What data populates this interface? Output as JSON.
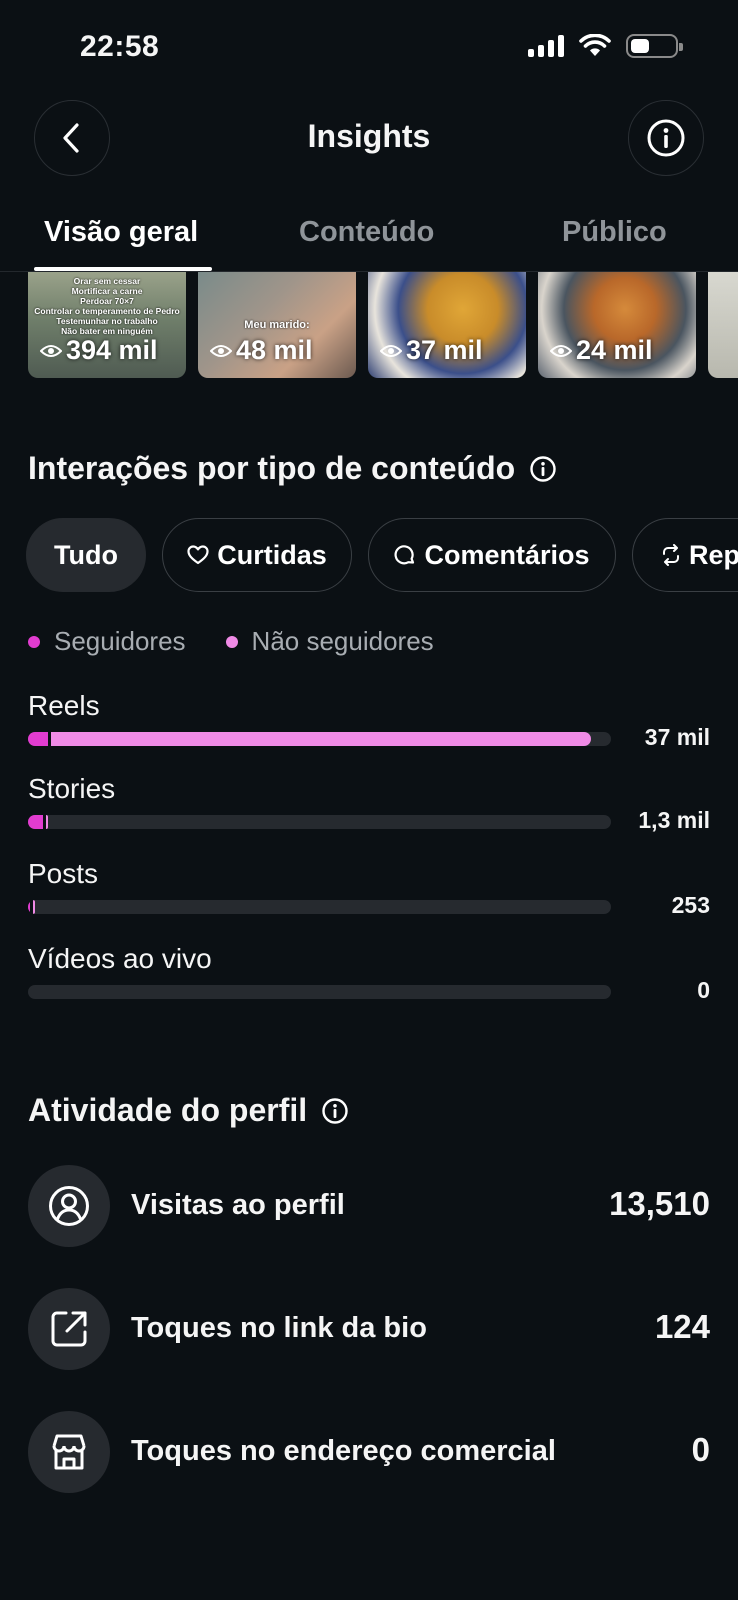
{
  "status_bar": {
    "time": "22:58"
  },
  "header": {
    "title": "Insights"
  },
  "tabs": [
    {
      "label": "Visão geral",
      "active": true
    },
    {
      "label": "Conteúdo",
      "active": false
    },
    {
      "label": "Público",
      "active": false
    }
  ],
  "thumbnails": [
    {
      "views": "394 mil",
      "caption": "Orar sem cessar\nMortificar a carne\nPerdoar 70×7\nControlar o temperamento de Pedro\nTestemunhar no trabalho\nNão bater em ninguém"
    },
    {
      "views": "48 mil",
      "caption": "Meu marido:"
    },
    {
      "views": "37 mil",
      "caption": ""
    },
    {
      "views": "24 mil",
      "caption": ""
    }
  ],
  "interactions": {
    "title": "Interações por tipo de conteúdo",
    "filters": [
      {
        "label": "Tudo",
        "icon": "",
        "active": true
      },
      {
        "label": "Curtidas",
        "icon": "heart-icon",
        "active": false
      },
      {
        "label": "Comentários",
        "icon": "comment-icon",
        "active": false
      },
      {
        "label": "Rep",
        "icon": "repost-icon",
        "active": false
      }
    ],
    "legend": [
      {
        "label": "Seguidores",
        "color": "#e23cd0"
      },
      {
        "label": "Não seguidores",
        "color": "#f08be6"
      }
    ]
  },
  "chart_data": {
    "type": "bar",
    "orientation": "horizontal",
    "stacked": true,
    "categories": [
      "Reels",
      "Stories",
      "Posts",
      "Vídeos ao vivo"
    ],
    "value_labels": [
      "37 mil",
      "1,3 mil",
      "253",
      "0"
    ],
    "values": [
      37000,
      1300,
      253,
      0
    ],
    "series": [
      {
        "name": "Seguidores",
        "color": "#e23cd0",
        "fraction_of_max": [
          0.035,
          0.025,
          0.004,
          0
        ]
      },
      {
        "name": "Não seguidores",
        "color": "#f08be6",
        "fraction_of_max": [
          0.925,
          0.005,
          0.003,
          0
        ]
      }
    ],
    "legend_position": "top-left"
  },
  "profile_activity": {
    "title": "Atividade do perfil",
    "rows": [
      {
        "label": "Visitas ao perfil",
        "value": "13,510",
        "icon": "profile-circle-icon"
      },
      {
        "label": "Toques no link da bio",
        "value": "124",
        "icon": "external-link-icon"
      },
      {
        "label": "Toques no endereço comercial",
        "value": "0",
        "icon": "storefront-icon"
      }
    ]
  }
}
